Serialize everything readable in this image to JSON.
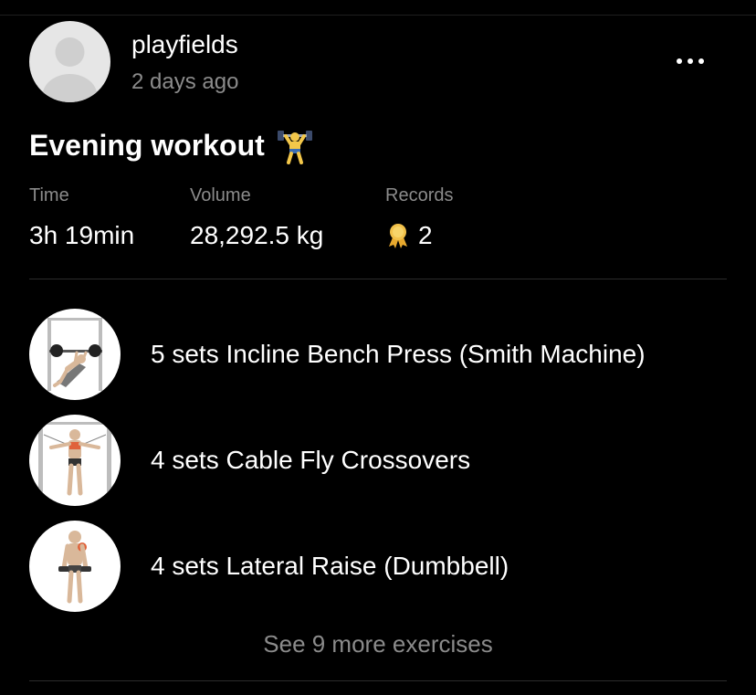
{
  "post": {
    "username": "playfields",
    "timestamp": "2 days ago",
    "avatar_icon": "default-avatar-icon",
    "more_icon": "more-horizontal-icon"
  },
  "workout": {
    "title": "Evening workout",
    "title_emoji_icon": "weight-lifter-icon"
  },
  "stats": {
    "time": {
      "label": "Time",
      "value": "3h 19min"
    },
    "volume": {
      "label": "Volume",
      "value": "28,292.5 kg"
    },
    "records": {
      "label": "Records",
      "value": "2",
      "icon": "medal-icon"
    }
  },
  "exercises": [
    {
      "label": "5 sets Incline Bench Press (Smith Machine)",
      "icon": "incline-bench-press-thumbnail"
    },
    {
      "label": "4 sets Cable Fly Crossovers",
      "icon": "cable-fly-thumbnail"
    },
    {
      "label": "4 sets Lateral Raise (Dumbbell)",
      "icon": "lateral-raise-thumbnail"
    }
  ],
  "see_more": "See 9 more exercises",
  "colors": {
    "background": "#000000",
    "text_primary": "#ffffff",
    "text_secondary": "#8b8b8b",
    "divider": "#2b2b2b",
    "avatar_bg": "#e6e6e6",
    "medal": "#f2c14a"
  }
}
